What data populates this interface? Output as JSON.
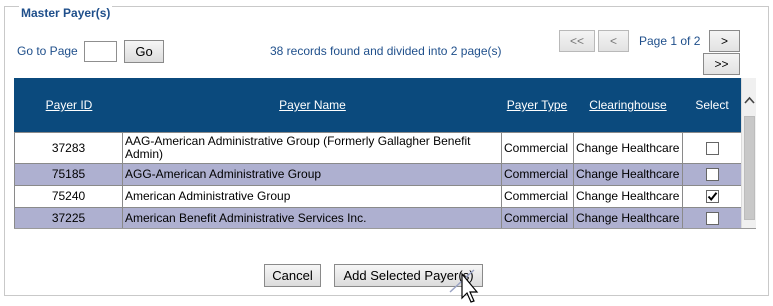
{
  "panel": {
    "title": "Master Payer(s)"
  },
  "paging": {
    "goto_label": "Go to Page",
    "goto_value": "",
    "go_label": "Go",
    "records_text": "38 records found and divided into 2 page(s)",
    "first_label": "<<",
    "prev_label": "<",
    "page_info": "Page 1 of 2",
    "next_label": ">",
    "last_label": ">>"
  },
  "grid": {
    "columns": {
      "payer_id": "Payer ID",
      "payer_name": "Payer Name",
      "payer_type": "Payer Type",
      "clearinghouse": "Clearinghouse",
      "select": "Select"
    },
    "rows": [
      {
        "id": "37283",
        "name": "AAG-American Administrative Group (Formerly Gallagher Benefit Admin)",
        "type": "Commercial",
        "clearinghouse": "Change Healthcare",
        "selected": false
      },
      {
        "id": "75185",
        "name": "AGG-American Administrative Group",
        "type": "Commercial",
        "clearinghouse": "Change Healthcare",
        "selected": false
      },
      {
        "id": "75240",
        "name": "American Administrative Group",
        "type": "Commercial",
        "clearinghouse": "Change Healthcare",
        "selected": true
      },
      {
        "id": "37225",
        "name": "American Benefit Administrative Services Inc.",
        "type": "Commercial",
        "clearinghouse": "Change Healthcare",
        "selected": false
      }
    ]
  },
  "actions": {
    "cancel_label": "Cancel",
    "add_label": "Add Selected Payer(s)"
  },
  "colors": {
    "header_bg": "#0b4a7d",
    "alt_row_bg": "#aeb0d0",
    "label_blue": "#1f4f8b"
  }
}
